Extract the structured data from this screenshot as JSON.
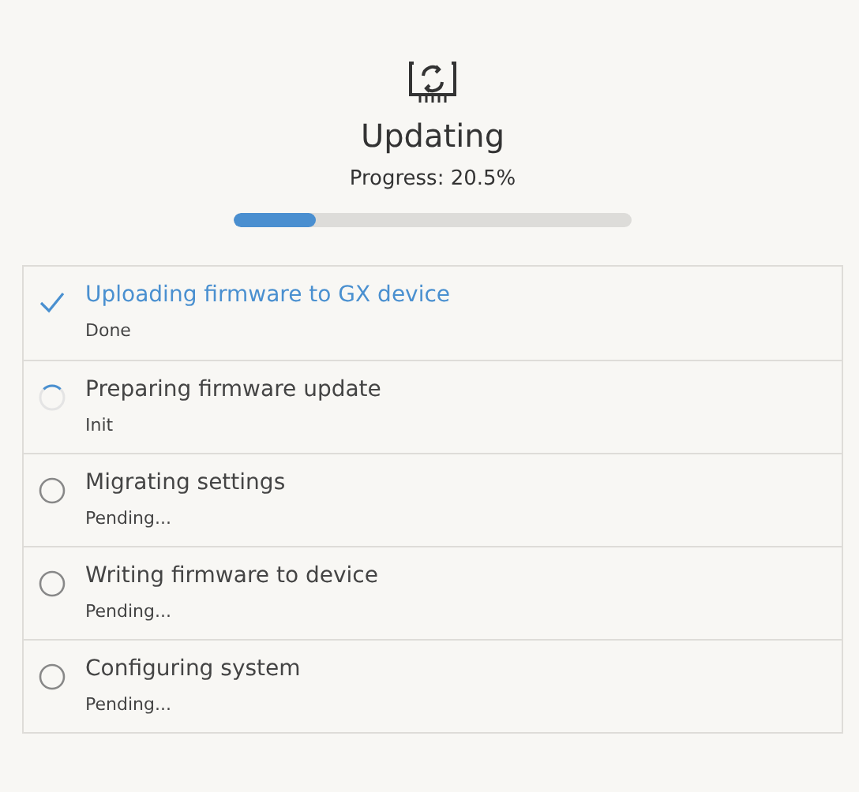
{
  "header": {
    "title": "Updating",
    "progress_text": "Progress: 20.5%",
    "level": 0.205
  },
  "steps": [
    {
      "title": "Uploading firmware to GX device",
      "status_text": "Done",
      "kind": "done"
    },
    {
      "title": "Preparing firmware update",
      "status_text": "Init",
      "kind": "active"
    },
    {
      "title": "Migrating settings",
      "status_text": "Pending...",
      "kind": "pending"
    },
    {
      "title": "Writing firmware to device",
      "status_text": "Pending...",
      "kind": "pending"
    },
    {
      "title": "Configuring system",
      "status_text": "Pending...",
      "kind": "pending"
    }
  ]
}
